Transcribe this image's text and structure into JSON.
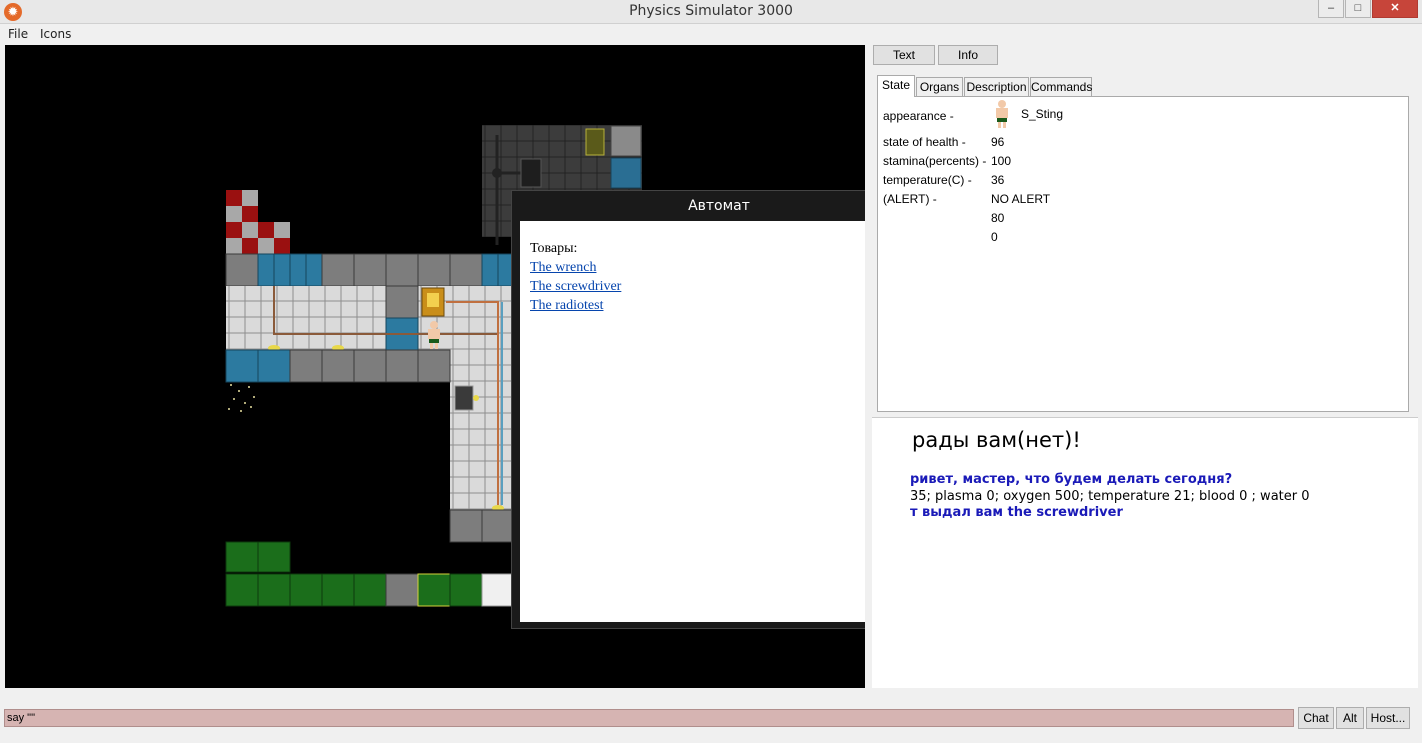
{
  "window": {
    "title": "Physics Simulator 3000",
    "minimize": "–",
    "maximize": "□",
    "close": "✕",
    "app_icon": "✹"
  },
  "menu": {
    "file": "File",
    "icons": "Icons"
  },
  "popup": {
    "title": "Автомат",
    "heading": "Товары:",
    "items": [
      "The wrench",
      "The screwdriver",
      "The radiotest"
    ],
    "scroll_up": "˄",
    "scroll_down": "˅"
  },
  "panel": {
    "buttons": {
      "text": "Text",
      "info": "Info"
    },
    "tabs": {
      "state": "State",
      "organs": "Organs",
      "description": "Description",
      "commands": "Commands"
    },
    "state": {
      "appearance_label": "appearance -",
      "appearance_value": "S_Sting",
      "rows": [
        {
          "label": "state of health -",
          "value": "96"
        },
        {
          "label": "stamina(percents) -",
          "value": "100"
        },
        {
          "label": "temperature(C) -",
          "value": "36"
        },
        {
          "label": "(ALERT) -",
          "value": "NO ALERT"
        },
        {
          "label": "",
          "value": "80"
        },
        {
          "label": "",
          "value": "0"
        }
      ]
    }
  },
  "chat": {
    "big": "рады вам(нет)!",
    "line1": "ривет, мастер, что будем делать сегодня?",
    "line2": "35; plasma 0; oxygen 500; temperature 21; blood 0 ; water 0",
    "line3": "т выдал вам the screwdriver"
  },
  "bottom": {
    "input_value": "say \"\"",
    "chat": "Chat",
    "alt": "Alt",
    "host": "Host..."
  },
  "colors": {
    "input_bg": "#d6b4b2",
    "link": "#0645ad",
    "chat_blue": "#1a1ab8"
  }
}
